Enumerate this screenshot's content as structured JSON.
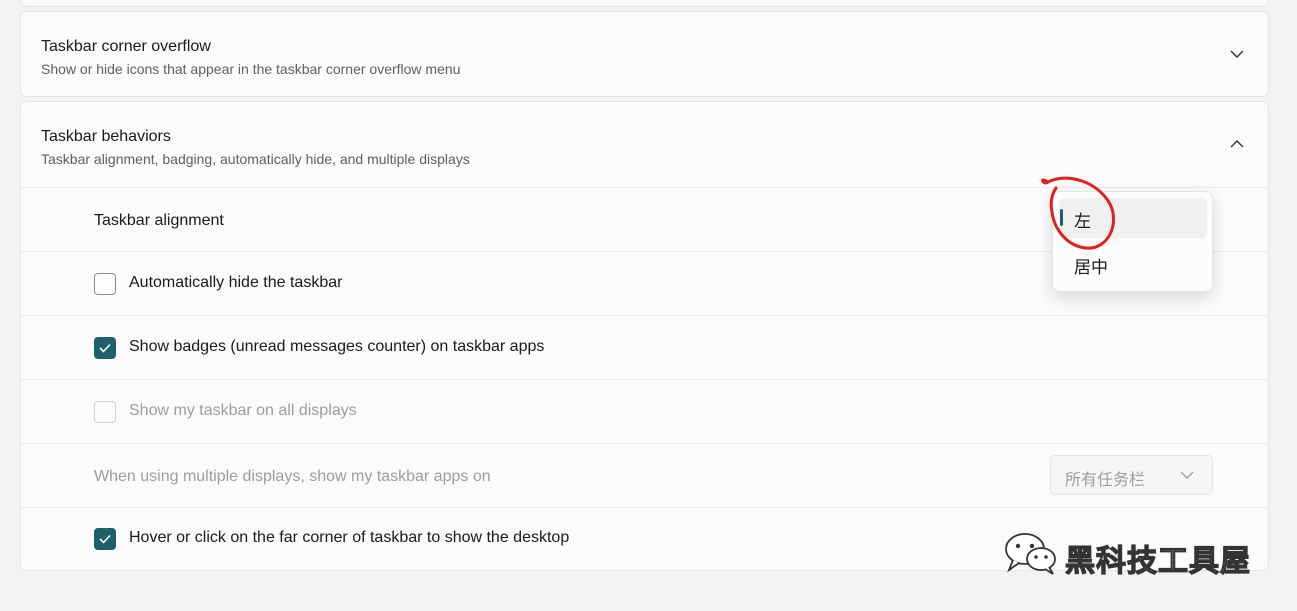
{
  "sections": {
    "overflow": {
      "title": "Taskbar corner overflow",
      "subtitle": "Show or hide icons that appear in the taskbar corner overflow menu",
      "chevron": "chevron-down-icon"
    },
    "behaviors": {
      "title": "Taskbar behaviors",
      "subtitle": "Taskbar alignment, badging, automatically hide, and multiple displays",
      "chevron": "chevron-up-icon"
    }
  },
  "settings": {
    "alignment": {
      "label": "Taskbar alignment"
    },
    "auto_hide": {
      "label": "Automatically hide the taskbar",
      "checked": false
    },
    "badges": {
      "label": "Show badges (unread messages counter) on taskbar apps",
      "checked": true
    },
    "all_displays": {
      "label": "Show my taskbar on all displays",
      "checked": false,
      "disabled": true
    },
    "multi_display": {
      "label": "When using multiple displays, show my taskbar apps on",
      "value": "所有任务栏",
      "disabled": true
    },
    "show_desktop": {
      "label": "Hover or click on the far corner of taskbar to show the desktop",
      "checked": true
    }
  },
  "alignment_menu": {
    "options": [
      "左",
      "居中"
    ],
    "selected": "左"
  },
  "watermark": {
    "text": "黑科技工具屋",
    "icon": "wechat-icon"
  },
  "colors": {
    "accent": "#1d5f6a",
    "annotation": "#e01f1f"
  }
}
